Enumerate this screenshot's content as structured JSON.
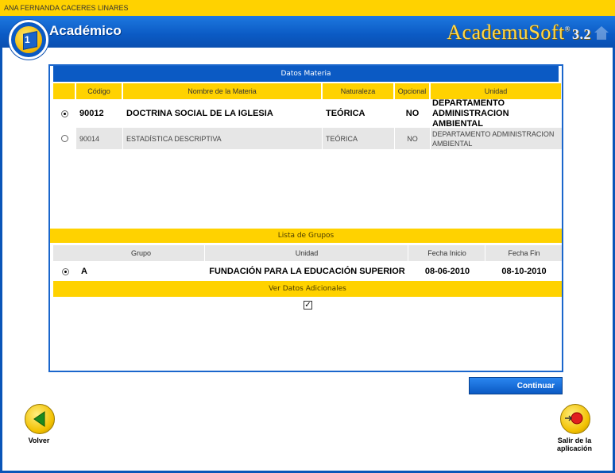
{
  "user": {
    "name": "ANA FERNANDA CACERES LINARES"
  },
  "header": {
    "title": "Académico",
    "brand": "AcademuSoft",
    "brand_mark": "®",
    "version": "3.2"
  },
  "materia": {
    "section_title": "Datos Materia",
    "columns": [
      "Código",
      "Nombre de la Materia",
      "Naturaleza",
      "Opcional",
      "Unidad"
    ],
    "rows": [
      {
        "selected": true,
        "codigo": "90012",
        "nombre": "DOCTRINA SOCIAL DE LA IGLESIA",
        "naturaleza": "TEÓRICA",
        "opcional": "NO",
        "unidad": "DEPARTAMENTO ADMINISTRACION AMBIENTAL"
      },
      {
        "selected": false,
        "codigo": "90014",
        "nombre": "ESTADÍSTICA DESCRIPTIVA",
        "naturaleza": "TEÓRICA",
        "opcional": "NO",
        "unidad": "DEPARTAMENTO ADMINISTRACION AMBIENTAL"
      }
    ]
  },
  "grupos": {
    "section_title": "Lista de Grupos",
    "columns": [
      "Grupo",
      "Unidad",
      "Fecha Inicio",
      "Fecha Fin"
    ],
    "rows": [
      {
        "selected": true,
        "grupo": "A",
        "unidad": "FUNDACIÓN PARA LA EDUCACIÓN SUPERIOR",
        "fecha_inicio": "08-06-2010",
        "fecha_fin": "08-10-2010"
      }
    ]
  },
  "adicionales": {
    "label": "Ver Datos Adicionales",
    "checked": true,
    "check_glyph": "✓"
  },
  "actions": {
    "continuar": "Continuar",
    "volver": "Volver",
    "salir": "Salir de la aplicación"
  },
  "colors": {
    "accent_blue": "#0b5ac4",
    "accent_yellow": "#ffd200"
  }
}
